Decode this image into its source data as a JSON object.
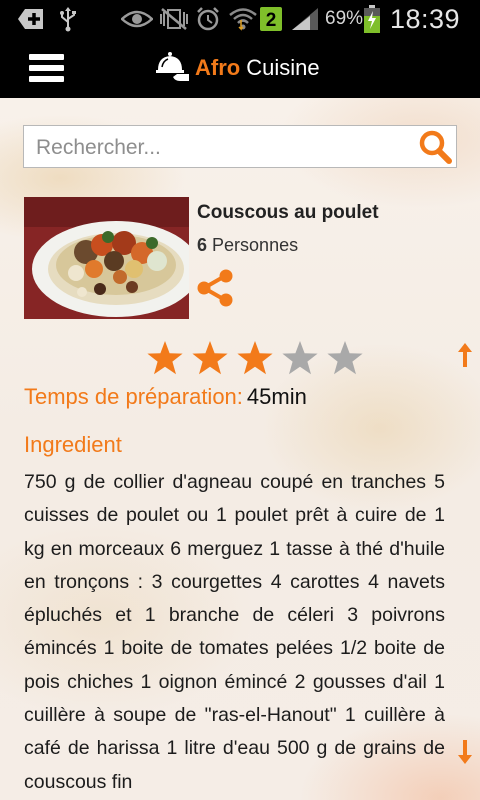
{
  "status_bar": {
    "battery_percent": "69%",
    "time": "18:39",
    "notification_badge": "2",
    "icons": [
      "add-box-icon",
      "usb-icon",
      "eye-icon",
      "no-vibrate-icon",
      "alarm-icon",
      "wifi-icon",
      "sim-badge-icon",
      "signal-icon",
      "battery-charging-icon"
    ]
  },
  "app_bar": {
    "menu_icon": "hamburger-menu-icon",
    "logo_icon": "cloche-serving-icon",
    "title_brand": "Afro",
    "title_rest": "Cuisine"
  },
  "search": {
    "placeholder": "Rechercher...",
    "value": "",
    "icon": "search-icon"
  },
  "recipe": {
    "title": "Couscous au poulet",
    "servings_count": "6",
    "servings_label": "Personnes",
    "share_icon": "share-icon",
    "rating": 3,
    "rating_max": 5,
    "prep_label": "Temps de préparation:",
    "prep_value": "45min",
    "ingredients_heading": "Ingredient",
    "ingredients_text": "750 g de collier d'agneau coupé en tranches 5 cuisses de poulet ou 1 poulet prêt à cuire de 1 kg en morceaux 6 merguez 1 tasse à thé d'huile en tronçons : 3 courgettes 4 carottes 4 navets épluchés et 1 branche de céleri 3 poivrons émincés 1 boite de tomates pelées 1/2 boite de pois chiches 1 oignon émincé 2 gousses d'ail 1 cuillère à soupe de \"ras-el-Hanout\" 1 cuillère à café de harissa 1 litre d'eau 500 g de grains de couscous fin"
  },
  "colors": {
    "accent": "#f27a1a",
    "bar": "#000000",
    "star_empty": "#a9a9a9"
  }
}
